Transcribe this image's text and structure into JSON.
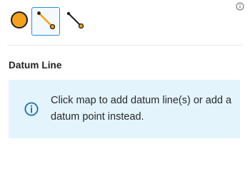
{
  "header": {
    "info_icon": "info-icon"
  },
  "toolbar": {
    "tools": [
      {
        "name": "point",
        "icon": "orange-point-icon",
        "color": "#f4a11e",
        "selected": false
      },
      {
        "name": "line-active",
        "icon": "orange-line-icon",
        "color": "#f4a11e",
        "selected": true
      },
      {
        "name": "line",
        "icon": "black-line-icon",
        "color": "#1f1f1f",
        "selected": false
      }
    ],
    "selected_border_color": "#2b8fd6"
  },
  "section": {
    "title": "Datum Line"
  },
  "hint": {
    "icon": "info-circle-icon",
    "text": "Click map to add datum line(s) or add a datum point instead.",
    "background": "#e3f4fc",
    "icon_color": "#1b6fb4"
  }
}
